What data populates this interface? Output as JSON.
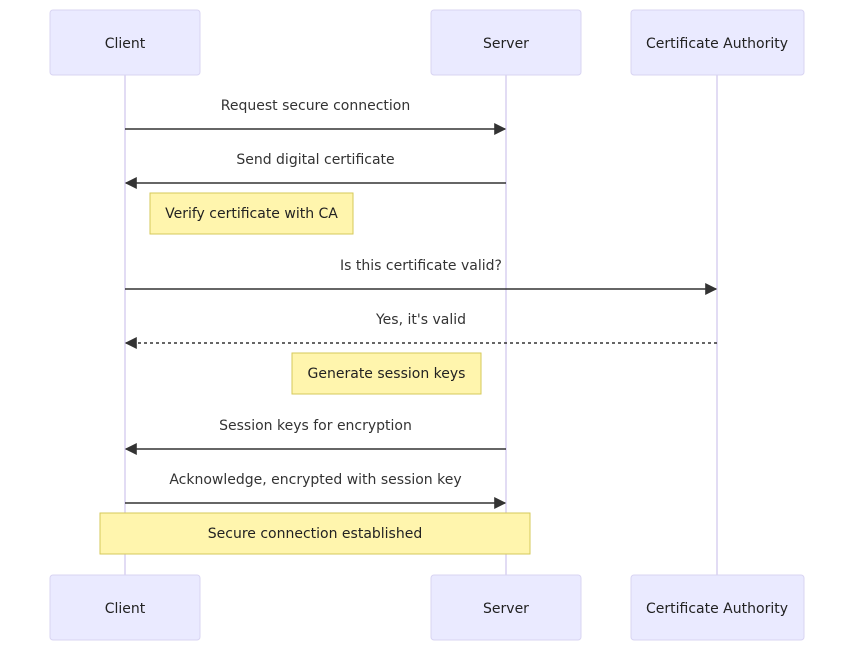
{
  "diagram_type": "sequence",
  "colors": {
    "actor_fill": "#eaeaff",
    "actor_border": "#d8d4f2",
    "note_fill": "#fff5ad",
    "note_border": "#d6c95a",
    "line": "#333333"
  },
  "participants": [
    {
      "id": "client",
      "label": "Client"
    },
    {
      "id": "server",
      "label": "Server"
    },
    {
      "id": "ca",
      "label": "Certificate Authority"
    }
  ],
  "messages": [
    {
      "from": "client",
      "to": "server",
      "label": "Request secure connection",
      "style": "solid"
    },
    {
      "from": "server",
      "to": "client",
      "label": "Send digital certificate",
      "style": "solid"
    },
    {
      "from": "client",
      "to": "ca",
      "label": "Is this certificate valid?",
      "style": "solid"
    },
    {
      "from": "ca",
      "to": "client",
      "label": "Yes, it's valid",
      "style": "dotted"
    },
    {
      "from": "server",
      "to": "client",
      "label": "Session keys for encryption",
      "style": "solid"
    },
    {
      "from": "client",
      "to": "server",
      "label": "Acknowledge, encrypted with session key",
      "style": "solid"
    }
  ],
  "notes": [
    {
      "position": "right of client",
      "label": "Verify certificate with CA"
    },
    {
      "position": "left of server",
      "label": "Generate session keys"
    },
    {
      "position": "over client, server",
      "label": "Secure connection established"
    }
  ]
}
